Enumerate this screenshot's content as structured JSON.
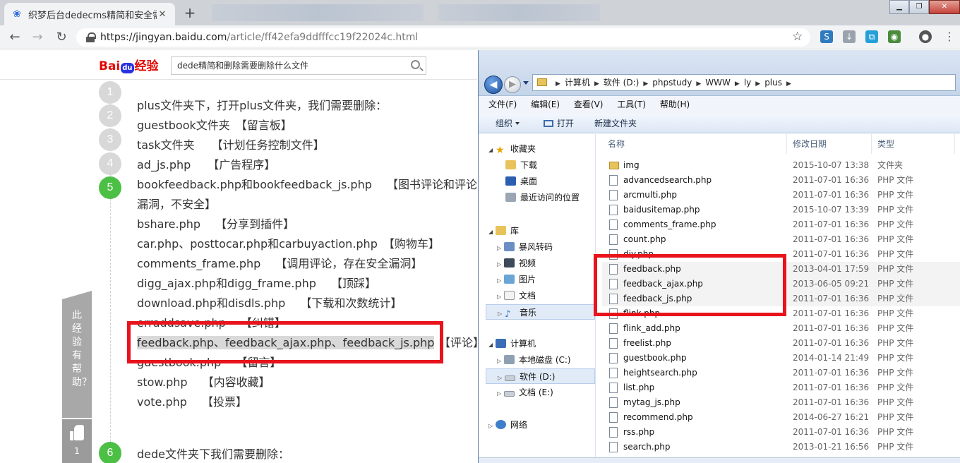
{
  "browser": {
    "tab_title": "织梦后台dedecms精简和安全需",
    "tab_close": "✕",
    "new_tab": "+",
    "url_host": "https://jingyan.baidu.com",
    "url_path": "/article/ff42efa9ddfffcc19f22024c.html",
    "win_min": "▁",
    "win_max": "❐",
    "win_close": "✕"
  },
  "baidu": {
    "logo_bai": "Bai",
    "logo_du": "du",
    "logo_jingyan": "经验",
    "search_value": "dede精简和删除需要删除什么文件",
    "steps": [
      "1",
      "2",
      "3",
      "4",
      "5",
      "6"
    ],
    "lines": [
      "plus文件夹下，打开plus文件夹，我们需要删除：",
      "guestbook文件夹　【留言板】",
      "task文件夹　　【计划任务控制文件】",
      "ad_js.php　　【广告程序】",
      "bookfeedback.php和bookfeedback_js.php　 【图书评论和评论调",
      "漏洞，不安全】",
      "bshare.php　 【分享到插件】",
      "car.php、posttocar.php和carbuyaction.php　【购物车】",
      "comments_frame.php　 【调用评论，存在安全漏洞】",
      "digg_ajax.php和digg_frame.php　 【顶踩】",
      "download.php和disdls.php　 【下载和次数统计】",
      "erraddsave.php　 【纠错】",
      "feedback.php、feedback_ajax.php、feedback_js.php",
      "【评论】",
      "guestbook.php　 【留言】",
      "stow.php　 【内容收藏】",
      "vote.php　 【投票】",
      "dede文件夹下我们需要删除："
    ],
    "help_text": "此经验有帮助？",
    "thumb_count": "1"
  },
  "explorer": {
    "crumbs": [
      "计算机",
      "软件 (D:)",
      "phpstudy",
      "WWW",
      "ly",
      "plus"
    ],
    "menu": [
      "文件(F)",
      "编辑(E)",
      "查看(V)",
      "工具(T)",
      "帮助(H)"
    ],
    "cmd_organize": "组织",
    "cmd_open": "打开",
    "cmd_newfolder": "新建文件夹",
    "nav": {
      "favorites": "收藏夹",
      "downloads": "下载",
      "desktop": "桌面",
      "recent": "最近访问的位置",
      "libraries": "库",
      "storm": "暴风转码",
      "videos": "视频",
      "pictures": "图片",
      "documents": "文档",
      "music": "音乐",
      "computer": "计算机",
      "drive_c": "本地磁盘 (C:)",
      "drive_d": "软件 (D:)",
      "drive_e": "文档 (E:)",
      "network": "网络"
    },
    "columns": {
      "name": "名称",
      "date": "修改日期",
      "type": "类型"
    },
    "files": [
      {
        "name": "img",
        "date": "2015-10-07 13:38",
        "type": "文件夹",
        "folder": true
      },
      {
        "name": "advancedsearch.php",
        "date": "2011-07-01 16:36",
        "type": "PHP 文件"
      },
      {
        "name": "arcmulti.php",
        "date": "2011-07-01 16:36",
        "type": "PHP 文件"
      },
      {
        "name": "baidusitemap.php",
        "date": "2015-10-07 13:39",
        "type": "PHP 文件"
      },
      {
        "name": "comments_frame.php",
        "date": "2011-07-01 16:36",
        "type": "PHP 文件"
      },
      {
        "name": "count.php",
        "date": "2011-07-01 16:36",
        "type": "PHP 文件"
      },
      {
        "name": "diy.php",
        "date": "2011-07-01 16:36",
        "type": "PHP 文件"
      },
      {
        "name": "feedback.php",
        "date": "2013-04-01 17:59",
        "type": "PHP 文件",
        "hl": true
      },
      {
        "name": "feedback_ajax.php",
        "date": "2013-06-05 09:21",
        "type": "PHP 文件",
        "hl": true
      },
      {
        "name": "feedback_js.php",
        "date": "2011-07-01 16:36",
        "type": "PHP 文件",
        "hl": true
      },
      {
        "name": "flink.php",
        "date": "2011-07-01 16:36",
        "type": "PHP 文件"
      },
      {
        "name": "flink_add.php",
        "date": "2011-07-01 16:36",
        "type": "PHP 文件"
      },
      {
        "name": "freelist.php",
        "date": "2011-07-01 16:36",
        "type": "PHP 文件"
      },
      {
        "name": "guestbook.php",
        "date": "2014-01-14 21:49",
        "type": "PHP 文件"
      },
      {
        "name": "heightsearch.php",
        "date": "2011-07-01 16:36",
        "type": "PHP 文件"
      },
      {
        "name": "list.php",
        "date": "2011-07-01 16:36",
        "type": "PHP 文件"
      },
      {
        "name": "mytag_js.php",
        "date": "2011-07-01 16:36",
        "type": "PHP 文件"
      },
      {
        "name": "recommend.php",
        "date": "2014-06-27 16:21",
        "type": "PHP 文件"
      },
      {
        "name": "rss.php",
        "date": "2011-07-01 16:36",
        "type": "PHP 文件"
      },
      {
        "name": "search.php",
        "date": "2013-01-21 16:56",
        "type": "PHP 文件"
      }
    ]
  },
  "colors": {
    "annotation_red": "#e8131b",
    "step_active": "#4cbf45",
    "step_inactive": "#d8d8d8",
    "baidu_red": "#e10601",
    "baidu_blue": "#2932e1"
  }
}
